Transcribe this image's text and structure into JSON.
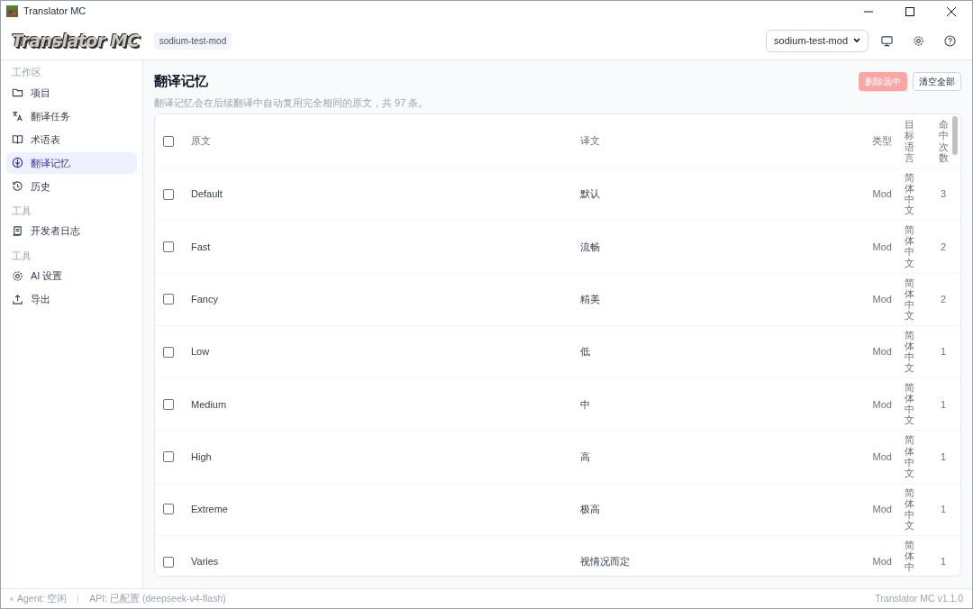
{
  "window": {
    "title": "Translator MC"
  },
  "header": {
    "logo": "Translator MC",
    "project_badge": "sodium-test-mod",
    "project_select": "sodium-test-mod"
  },
  "sidebar": {
    "sections": [
      {
        "title": "工作区",
        "items": [
          {
            "label": "项目",
            "selected": false
          },
          {
            "label": "翻译任务",
            "selected": false
          },
          {
            "label": "术语表",
            "selected": false
          },
          {
            "label": "翻译记忆",
            "selected": true
          },
          {
            "label": "历史",
            "selected": false
          }
        ]
      },
      {
        "title": "工具",
        "items": [
          {
            "label": "开发者日志",
            "selected": false
          }
        ]
      },
      {
        "title": "工具",
        "items": [
          {
            "label": "AI 设置",
            "selected": false
          },
          {
            "label": "导出",
            "selected": false
          }
        ]
      }
    ]
  },
  "page": {
    "title": "翻译记忆",
    "description": "翻译记忆会在后续翻译中自动复用完全相同的原文，共 97 条。",
    "delete_button": {
      "label": "删除选中",
      "disabled": true
    },
    "clear_button": "清空全部"
  },
  "table": {
    "all_checked": false,
    "columns": [
      "原文",
      "译文",
      "类型",
      "目标语言",
      "命中次数"
    ],
    "rows": [
      {
        "checked": false,
        "source": "Default",
        "target": "默认",
        "type": "Mod",
        "lang": "简体中文",
        "hits": "3"
      },
      {
        "checked": false,
        "source": "Fast",
        "target": "流畅",
        "type": "Mod",
        "lang": "简体中文",
        "hits": "2"
      },
      {
        "checked": false,
        "source": "Fancy",
        "target": "精美",
        "type": "Mod",
        "lang": "简体中文",
        "hits": "2"
      },
      {
        "checked": false,
        "source": "Low",
        "target": "低",
        "type": "Mod",
        "lang": "简体中文",
        "hits": "1"
      },
      {
        "checked": false,
        "source": "Medium",
        "target": "中",
        "type": "Mod",
        "lang": "简体中文",
        "hits": "1"
      },
      {
        "checked": false,
        "source": "High",
        "target": "高",
        "type": "Mod",
        "lang": "简体中文",
        "hits": "1"
      },
      {
        "checked": false,
        "source": "Extreme",
        "target": "极高",
        "type": "Mod",
        "lang": "简体中文",
        "hits": "1"
      },
      {
        "checked": false,
        "source": "Varies",
        "target": "视情况而定",
        "type": "Mod",
        "lang": "简体中",
        "hits": "1"
      }
    ]
  },
  "status_bar": {
    "agent": "Agent: 空闲",
    "api": "API: 已配置 (deepseek-v4-flash)",
    "version": "Translator MC v1.1.0"
  }
}
